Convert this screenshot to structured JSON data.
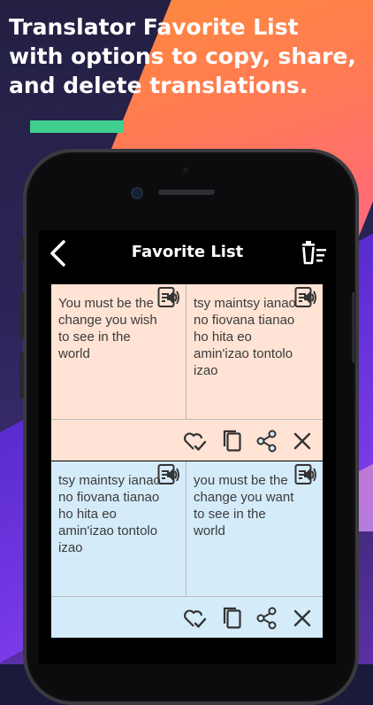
{
  "promo": {
    "headline_lines": [
      "Translator Favorite List",
      "with options to copy, share,",
      "and delete translations."
    ],
    "colors": {
      "accent": "#3ecf8e",
      "orange": "#ff8a3c",
      "purple": "#5a2bd0"
    }
  },
  "appbar": {
    "title": "Favorite List",
    "back_icon": "chevron-left-icon",
    "delete_all_icon": "delete-all-icon"
  },
  "favorites": [
    {
      "source": "You must be the change you wish to see in the world",
      "translation": "tsy maintsy ianao no fiovana tianao ho hita eo amin'izao tontolo izao",
      "color": "#ffe3d4"
    },
    {
      "source": "tsy maintsy ianao no fiovana tianao ho hita eo amin'izao tontolo izao",
      "translation": "you must be the change you want to see in the world",
      "color": "#d4ebf9"
    }
  ],
  "action_icons": [
    "favorite-check-icon",
    "copy-icon",
    "share-icon",
    "close-icon"
  ]
}
